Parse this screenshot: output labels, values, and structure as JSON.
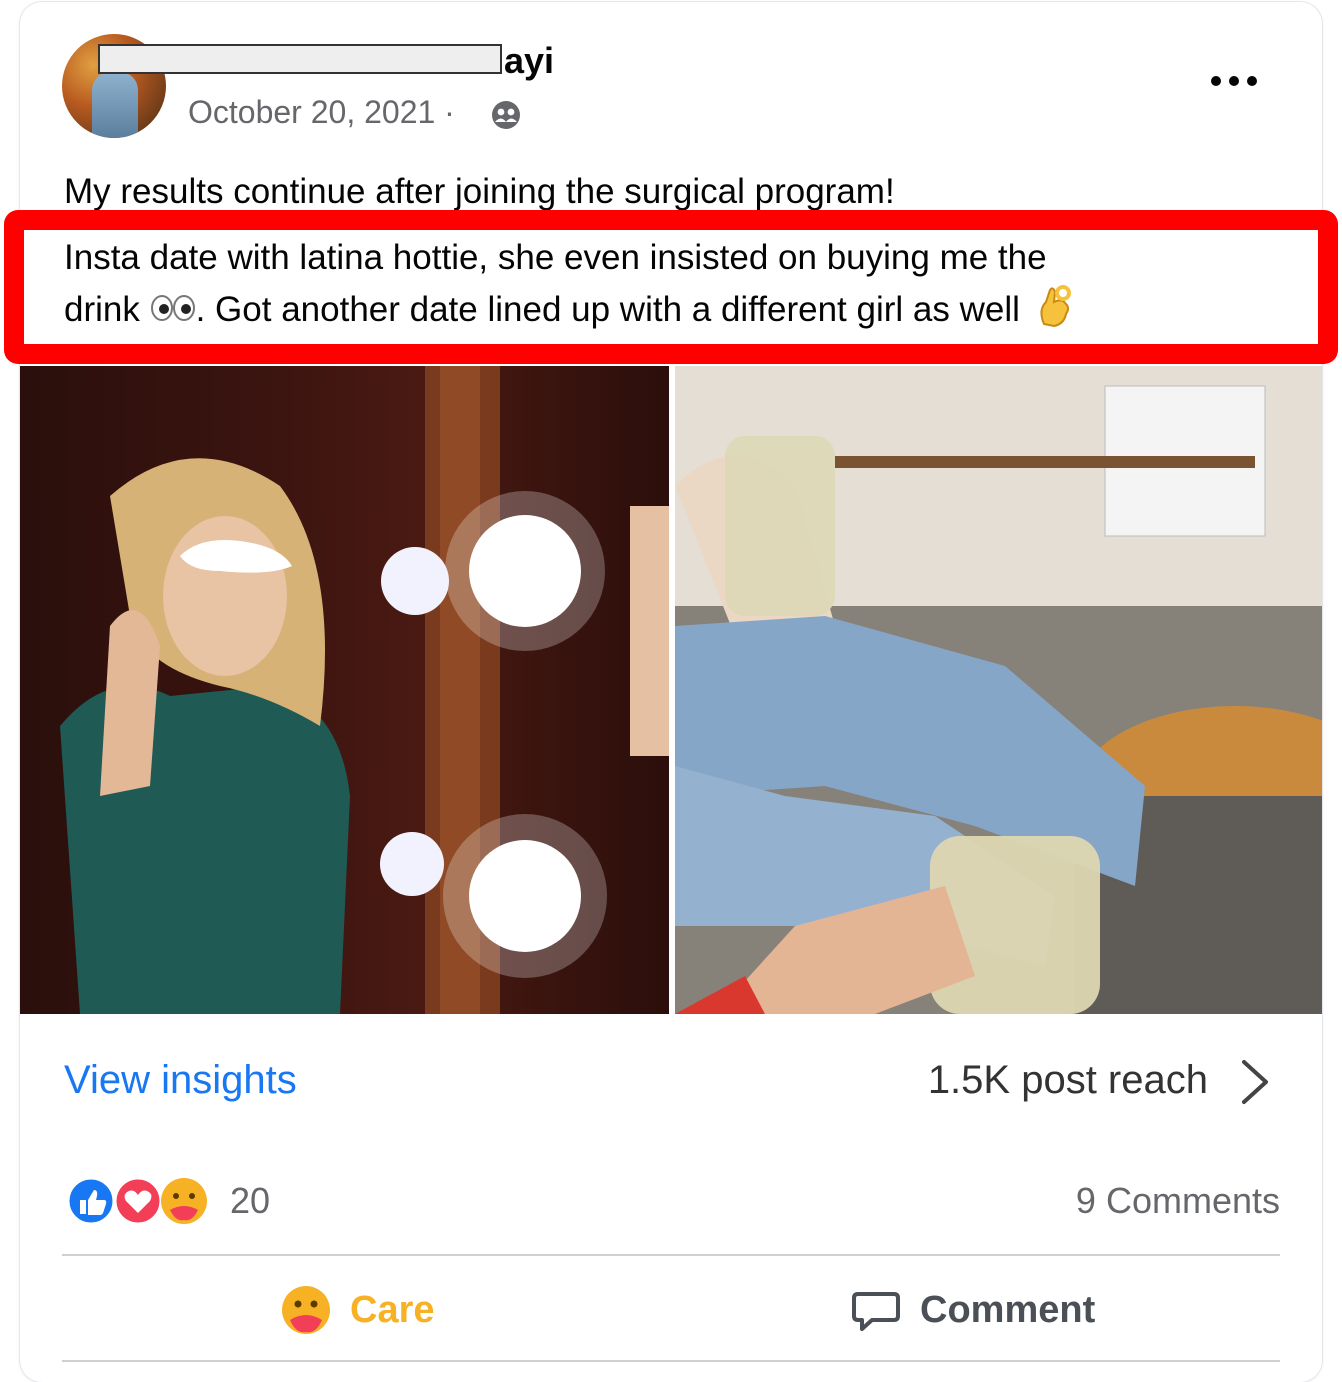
{
  "post": {
    "author_suffix": "ayi",
    "date": "October 20, 2021 ·",
    "text_line1": "My results continue after joining the surgical program!",
    "highlight_line1": "Insta date with latina hottie, she even insisted on buying me the",
    "highlight_line2_a": "drink",
    "highlight_line2_b": ". Got another date lined up with a different girl as well",
    "icons": {
      "audience": "friends-icon",
      "more": "more-options-icon",
      "eyes_emoji": "eyes-emoji",
      "ok_emoji": "ok-hand-emoji"
    }
  },
  "footer": {
    "insights_label": "View insights",
    "reach_label": "1.5K post reach",
    "reaction_count": "20",
    "comments_label": "9 Comments",
    "care_label": "Care",
    "comment_label": "Comment"
  },
  "colors": {
    "link": "#1877f2",
    "care": "#f7b125",
    "highlight_border": "#ff0000",
    "secondary_text": "#65676b"
  }
}
